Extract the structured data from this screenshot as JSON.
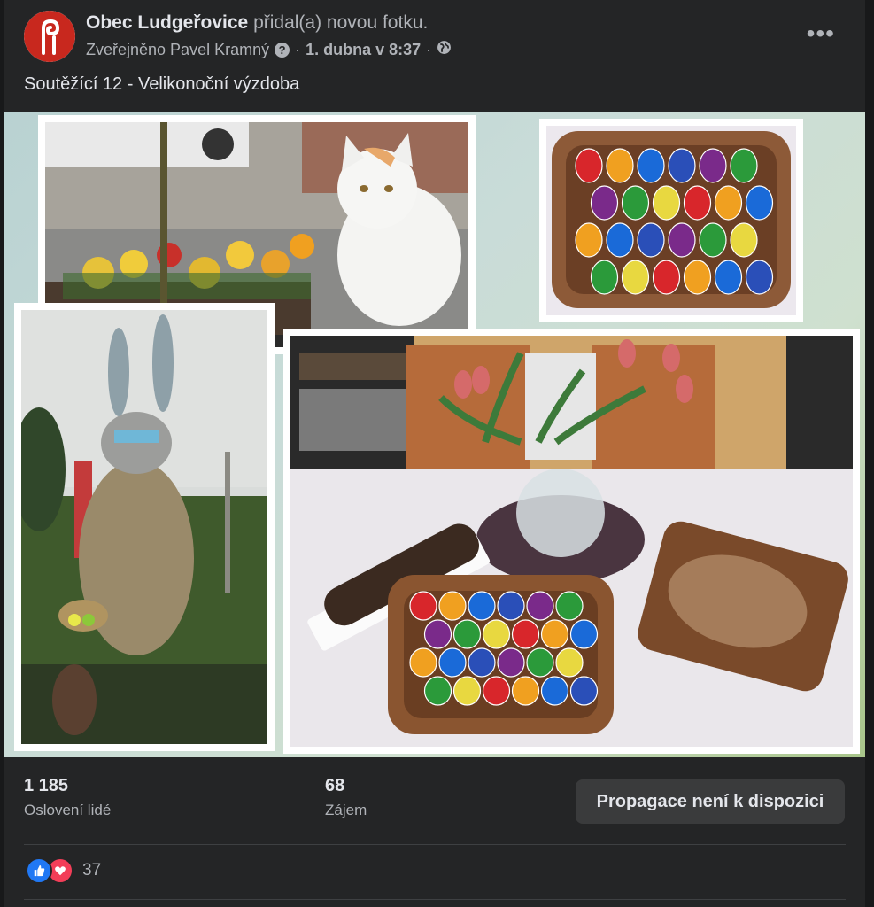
{
  "post": {
    "page_name": "Obec Ludgeřovice",
    "action": "přidal(a) novou fotku.",
    "published_by": "Zveřejněno Pavel Kramný",
    "separator": "·",
    "date": "1. dubna v 8:37",
    "separator2": "·",
    "more_label": "•••",
    "text": "Soutěžící 12 - Velikonoční výzdoba"
  },
  "stats": {
    "reach_value": "1 185",
    "reach_label": "Oslovení lidé",
    "engagement_value": "68",
    "engagement_label": "Zájem",
    "promote_button": "Propagace není k dispozici"
  },
  "reactions": {
    "count": "37"
  },
  "icons": {
    "help": "question-icon",
    "audience": "globe-icon",
    "like": "like-icon",
    "love": "love-icon"
  },
  "colors": {
    "background": "#18191a",
    "card": "#242526",
    "primary_text": "#e4e6eb",
    "secondary_text": "#b0b3b8",
    "like_blue": "#2078f4",
    "love_red": "#f33e58"
  }
}
